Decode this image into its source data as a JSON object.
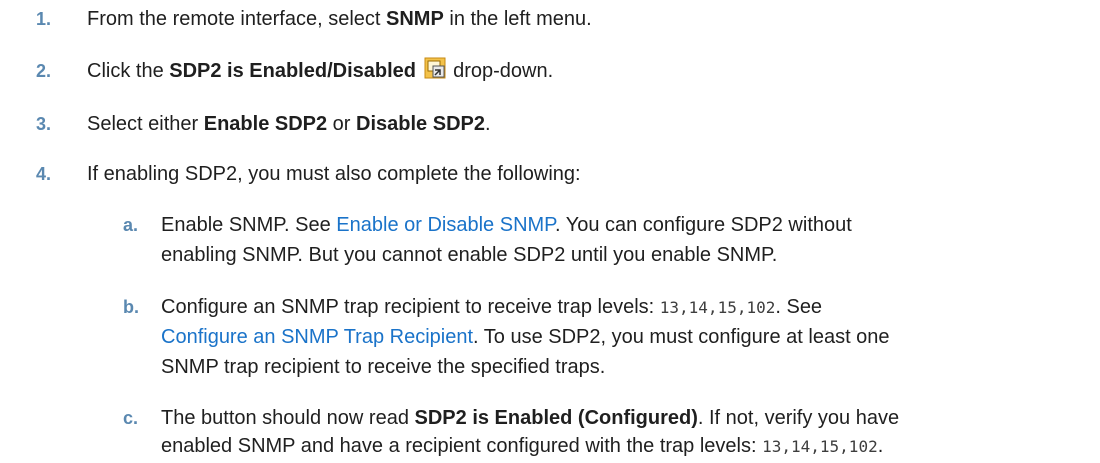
{
  "steps": [
    {
      "num": "1.",
      "pre": "From the remote interface, select ",
      "bold": "SNMP",
      "post": " in the left menu."
    },
    {
      "num": "2.",
      "pre": "Click the ",
      "bold": "SDP2 is Enabled/Disabled",
      "post": " drop-down.",
      "icon": "dropdown-icon"
    },
    {
      "num": "3.",
      "pre": "Select either ",
      "bold1": "Enable SDP2",
      "mid": " or ",
      "bold2": "Disable SDP2",
      "post": "."
    },
    {
      "num": "4.",
      "text": "If enabling SDP2, you must also complete the following:"
    }
  ],
  "substeps": [
    {
      "num": "a.",
      "line1_pre": "Enable SNMP. See ",
      "line1_link": "Enable or Disable SNMP",
      "line1_post": ". You can configure SDP2 without",
      "line2": "enabling SNMP. But you cannot enable SDP2 until you enable SNMP."
    },
    {
      "num": "b.",
      "line1_pre": "Configure an SNMP trap recipient to receive trap levels: ",
      "line1_code": "13,14,15,102",
      "line1_post": ". See",
      "line2_link": "Configure an SNMP Trap Recipient",
      "line2_post": ". To use SDP2, you must configure at least one",
      "line3": "SNMP trap recipient to receive the specified traps."
    },
    {
      "num": "c.",
      "line1_pre": "The button should now read ",
      "line1_bold": "SDP2 is Enabled (Configured)",
      "line1_post": ". If not, verify you have",
      "line2_pre": "enabled SNMP and have a recipient configured with the trap levels: ",
      "line2_code": "13,14,15,102",
      "line2_post": "."
    }
  ],
  "colors": {
    "step_number": "#5a88b0",
    "link": "#1a73c9",
    "text": "#1f1f1f"
  }
}
